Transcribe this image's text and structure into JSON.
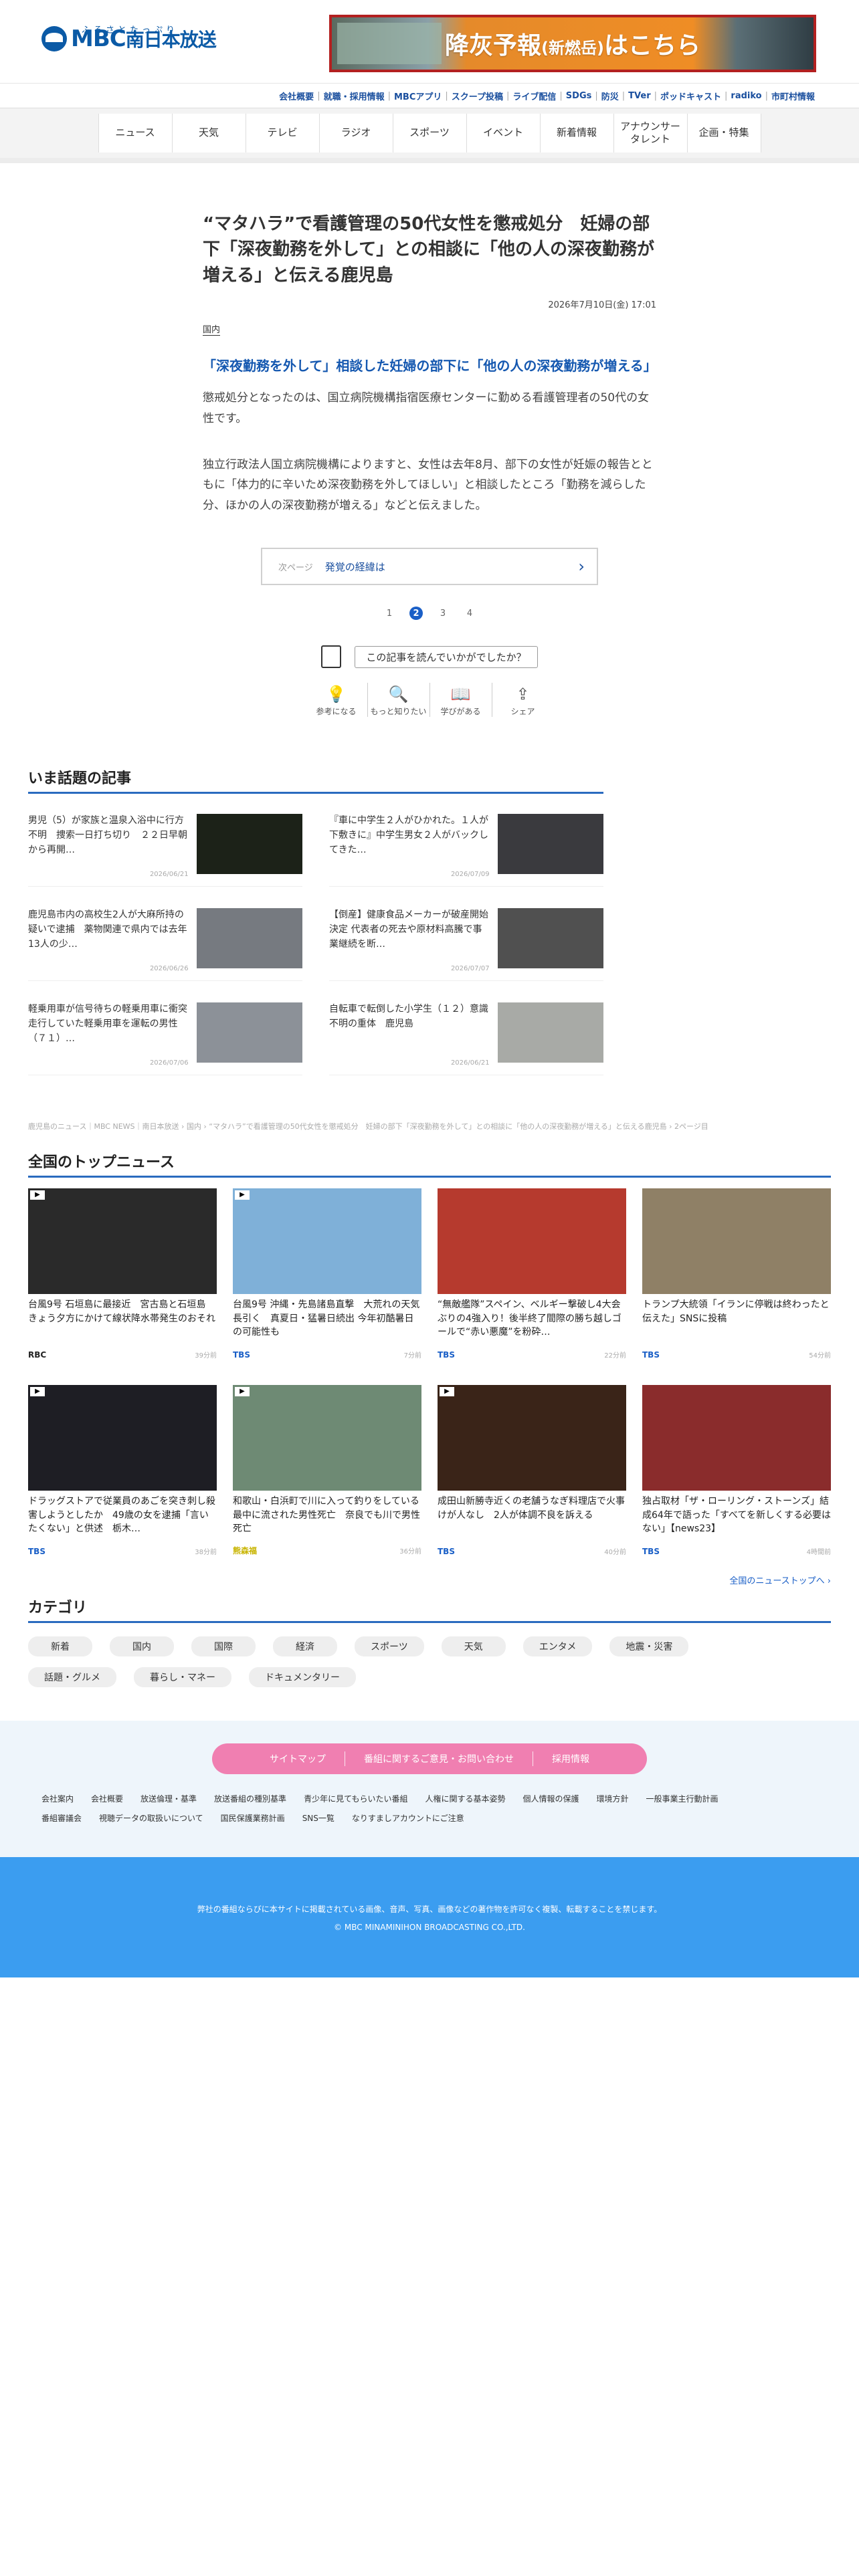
{
  "header": {
    "logo_ruby": "ふるさとたっぷり",
    "logo_main": "MBC",
    "logo_sub": "南日本放送",
    "banner_text": "降灰予報",
    "banner_paren": "(新燃岳)",
    "banner_link": "はこちら"
  },
  "utility_links": [
    "会社概要",
    "就職・採用情報",
    "MBCアプリ",
    "スクープ投稿",
    "ライブ配信",
    "SDGs",
    "防災",
    "TVer",
    "ポッドキャスト",
    "radiko",
    "市町村情報"
  ],
  "global_nav": [
    "ニュース",
    "天気",
    "テレビ",
    "ラジオ",
    "スポーツ",
    "イベント",
    "新着情報",
    "アナウンサー\nタレント",
    "企画・特集"
  ],
  "article": {
    "title": "“マタハラ”で看護管理の50代女性を懲戒処分　妊婦の部下「深夜勤務を外して」との相談に「他の人の深夜勤務が増える」と伝える鹿児島",
    "date": "2026年7月10日(金) 17:01",
    "category": "国内",
    "subheading": "「深夜勤務を外して」相談した妊婦の部下に「他の人の深夜勤務が増える」",
    "paragraphs": [
      "懲戒処分となったのは、国立病院機構指宿医療センターに勤める看護管理者の50代の女性です。",
      "独立行政法人国立病院機構によりますと、女性は去年8月、部下の女性が妊娠の報告とともに「体力的に辛いため深夜勤務を外してほしい」と相談したところ「勤務を減らした分、ほかの人の深夜勤務が増える」などと伝えました。"
    ],
    "next_label": "次ページ",
    "next_text": "発覚の経緯は",
    "pages": [
      "1",
      "2",
      "3",
      "4"
    ],
    "current_page": "2",
    "feedback_question": "この記事を読んでいかがでしたか？",
    "reactions": [
      {
        "icon": "lightbulb-icon",
        "glyph": "💡",
        "label": "参考になる"
      },
      {
        "icon": "search-icon",
        "glyph": "🔍",
        "label": "もっと知りたい"
      },
      {
        "icon": "book-icon",
        "glyph": "📖",
        "label": "学びがある"
      },
      {
        "icon": "share-icon",
        "glyph": "⇪",
        "label": "シェア"
      }
    ]
  },
  "trending": {
    "title": "いま話題の記事",
    "items": [
      {
        "title": "男児（5）が家族と温泉入浴中に行方不明　捜索一日打ち切り　２２日早朝から再開…",
        "date": "2026/06/21",
        "img": "#1c2218"
      },
      {
        "title": "『車に中学生２人がひかれた。１人が下敷きに』中学生男女２人がバックしてきた…",
        "date": "2026/07/09",
        "img": "#3a3a3e"
      },
      {
        "title": "鹿児島市内の高校生2人が大麻所持の疑いで逮捕　薬物関連で県内では去年13人の少…",
        "date": "2026/06/26",
        "img": "#767a80"
      },
      {
        "title": "【倒産】健康食品メーカーが破産開始決定 代表者の死去や原材料高騰で事業継続を断…",
        "date": "2026/07/07",
        "img": "#505050"
      },
      {
        "title": "軽乗用車が信号待ちの軽乗用車に衝突　走行していた軽乗用車を運転の男性（７１）…",
        "date": "2026/07/06",
        "img": "#8c9198"
      },
      {
        "title": "自転車で転倒した小学生（１２）意識不明の重体　鹿児島",
        "date": "2026/06/21",
        "img": "#a8aaa6"
      }
    ]
  },
  "breadcrumb": "鹿児島のニュース｜MBC NEWS｜南日本放送 › 国内 › “マタハラ”で看護管理の50代女性を懲戒処分　妊婦の部下「深夜勤務を外して」との相談に「他の人の深夜勤務が増える」と伝える鹿児島 › 2ページ目",
  "top_news": {
    "title": "全国のトップニュース",
    "items": [
      {
        "title": "台風9号 石垣島に最接近　宮古島と石垣島 きょう夕方にかけて線状降水帯発生のおそれ",
        "source": "RBC",
        "date": "39分前",
        "img": "#2a2a2a",
        "play": true,
        "src_color": "#222"
      },
      {
        "title": "台風9号 沖縄・先島諸島直撃　大荒れの天気長引く　真夏日・猛暑日続出 今年初酷暑日の可能性も",
        "source": "TBS",
        "date": "7分前",
        "img": "#7fb0d8",
        "play": true,
        "src_color": "#1a5fc7"
      },
      {
        "title": "“無敵艦隊”スペイン、ベルギー撃破し4大会ぶりの4強入り！後半終了間際の勝ち越しゴールで“赤い悪魔”を粉砕…",
        "source": "TBS",
        "date": "22分前",
        "img": "#b63a2e",
        "play": false,
        "src_color": "#1a5fc7"
      },
      {
        "title": "トランプ大統領「イランに停戦は終わったと伝えた」SNSに投稿",
        "source": "TBS",
        "date": "54分前",
        "img": "#8f8066",
        "play": false,
        "src_color": "#1a5fc7"
      },
      {
        "title": "ドラッグストアで従業員のあごを突き刺し殺害しようとしたか　49歳の女を逮捕「言いたくない」と供述　栃木…",
        "source": "TBS",
        "date": "38分前",
        "img": "#1e1e24",
        "play": true,
        "src_color": "#1a5fc7"
      },
      {
        "title": "和歌山・白浜町で川に入って釣りをしている最中に流された男性死亡　奈良でも川で男性死亡",
        "source": "熊森福",
        "date": "36分前",
        "img": "#6e8a74",
        "play": true,
        "src_color": "#c8b400"
      },
      {
        "title": "成田山新勝寺近くの老舗うなぎ料理店で火事　けが人なし　2人が体調不良を訴える",
        "source": "TBS",
        "date": "40分前",
        "img": "#3a2418",
        "play": true,
        "src_color": "#1a5fc7"
      },
      {
        "title": "独占取材「ザ・ローリング・ストーンズ」結成64年で語った「すべてを新しくする必要はない」【news23】",
        "source": "TBS",
        "date": "4時間前",
        "img": "#8a2c2c",
        "play": false,
        "src_color": "#1a5fc7"
      }
    ],
    "more_link": "全国のニューストップへ ›"
  },
  "categories": {
    "title": "カテゴリ",
    "items": [
      "新着",
      "国内",
      "国際",
      "経済",
      "スポーツ",
      "天気",
      "エンタメ",
      "地震・災害",
      "話題・グルメ",
      "暮らし・マネー",
      "ドキュメンタリー"
    ]
  },
  "footer": {
    "pill_links": [
      "サイトマップ",
      "番組に関するご意見・お問い合わせ",
      "採用情報"
    ],
    "links": [
      "会社案内",
      "会社概要",
      "放送倫理・基準",
      "放送番組の種別基準",
      "青少年に見てもらいたい番組",
      "人権に関する基本姿勢",
      "個人情報の保護",
      "環境方針",
      "一般事業主行動計画",
      "番組審議会",
      "視聴データの取扱いについて",
      "国民保護業務計画",
      "SNS一覧",
      "なりすましアカウントにご注意"
    ],
    "notice": "弊社の番組ならびに本サイトに掲載されている画像、音声、写真、画像などの著作物を許可なく複製、転載することを禁じます。",
    "copyright": "© MBC MINAMINIHON BROADCASTING CO.,LTD."
  }
}
